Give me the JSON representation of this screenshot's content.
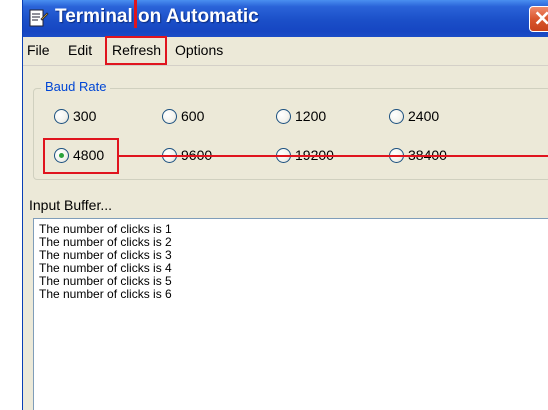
{
  "window": {
    "title": "Terminal on Automatic",
    "close_glyph": "×"
  },
  "icons": {
    "app": "terminal-app-icon",
    "close": "close-icon"
  },
  "menu": {
    "items": [
      {
        "label": "File"
      },
      {
        "label": "Edit"
      },
      {
        "label": "Refresh"
      },
      {
        "label": "Options"
      }
    ]
  },
  "baud": {
    "group_label": "Baud Rate",
    "selected": "4800",
    "options": [
      {
        "label": "300",
        "checked": false
      },
      {
        "label": "600",
        "checked": false
      },
      {
        "label": "1200",
        "checked": false
      },
      {
        "label": "2400",
        "checked": false
      },
      {
        "label": "4800",
        "checked": true
      },
      {
        "label": "9600",
        "checked": false
      },
      {
        "label": "19200",
        "checked": false
      },
      {
        "label": "38400",
        "checked": false
      }
    ]
  },
  "buffer": {
    "label": "Input Buffer...",
    "lines": [
      "The number of clicks is 1",
      "The number of clicks is 2",
      "The number of clicks is 3",
      "The number of clicks is 4",
      "The number of clicks is 5",
      "The number of clicks is 6"
    ]
  },
  "colors": {
    "titlebar": "#1b4fc8",
    "window_bg": "#ece9d8",
    "group_label": "#0046d5",
    "annotation": "#e0141e",
    "radio_checked": "#2ba23a"
  }
}
